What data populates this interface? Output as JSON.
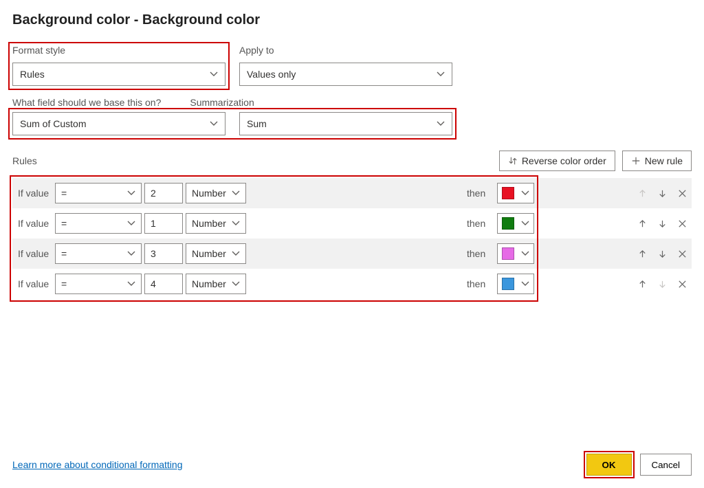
{
  "dialog_title": "Background color - Background color",
  "labels": {
    "format_style": "Format style",
    "apply_to": "Apply to",
    "base_field": "What field should we base this on?",
    "summarization": "Summarization",
    "rules": "Rules",
    "if_value": "If value",
    "then": "then"
  },
  "dropdowns": {
    "format_style": "Rules",
    "apply_to": "Values only",
    "base_field": "Sum of Custom",
    "summarization": "Sum"
  },
  "buttons": {
    "reverse": "Reverse color order",
    "new_rule": "New rule",
    "ok": "OK",
    "cancel": "Cancel"
  },
  "link_text": "Learn more about conditional formatting",
  "rules_list": [
    {
      "op": "=",
      "value": "2",
      "type": "Number",
      "color": "#e81123",
      "alt": true,
      "up_disabled": true,
      "down_disabled": false
    },
    {
      "op": "=",
      "value": "1",
      "type": "Number",
      "color": "#107c10",
      "alt": false,
      "up_disabled": false,
      "down_disabled": false
    },
    {
      "op": "=",
      "value": "3",
      "type": "Number",
      "color": "#e66be6",
      "alt": true,
      "up_disabled": false,
      "down_disabled": false
    },
    {
      "op": "=",
      "value": "4",
      "type": "Number",
      "color": "#3a96dd",
      "alt": false,
      "up_disabled": false,
      "down_disabled": true
    }
  ],
  "highlights": {
    "format_style_box": true,
    "field_summ_box": true,
    "rules_area_box": true,
    "ok_box": true
  }
}
